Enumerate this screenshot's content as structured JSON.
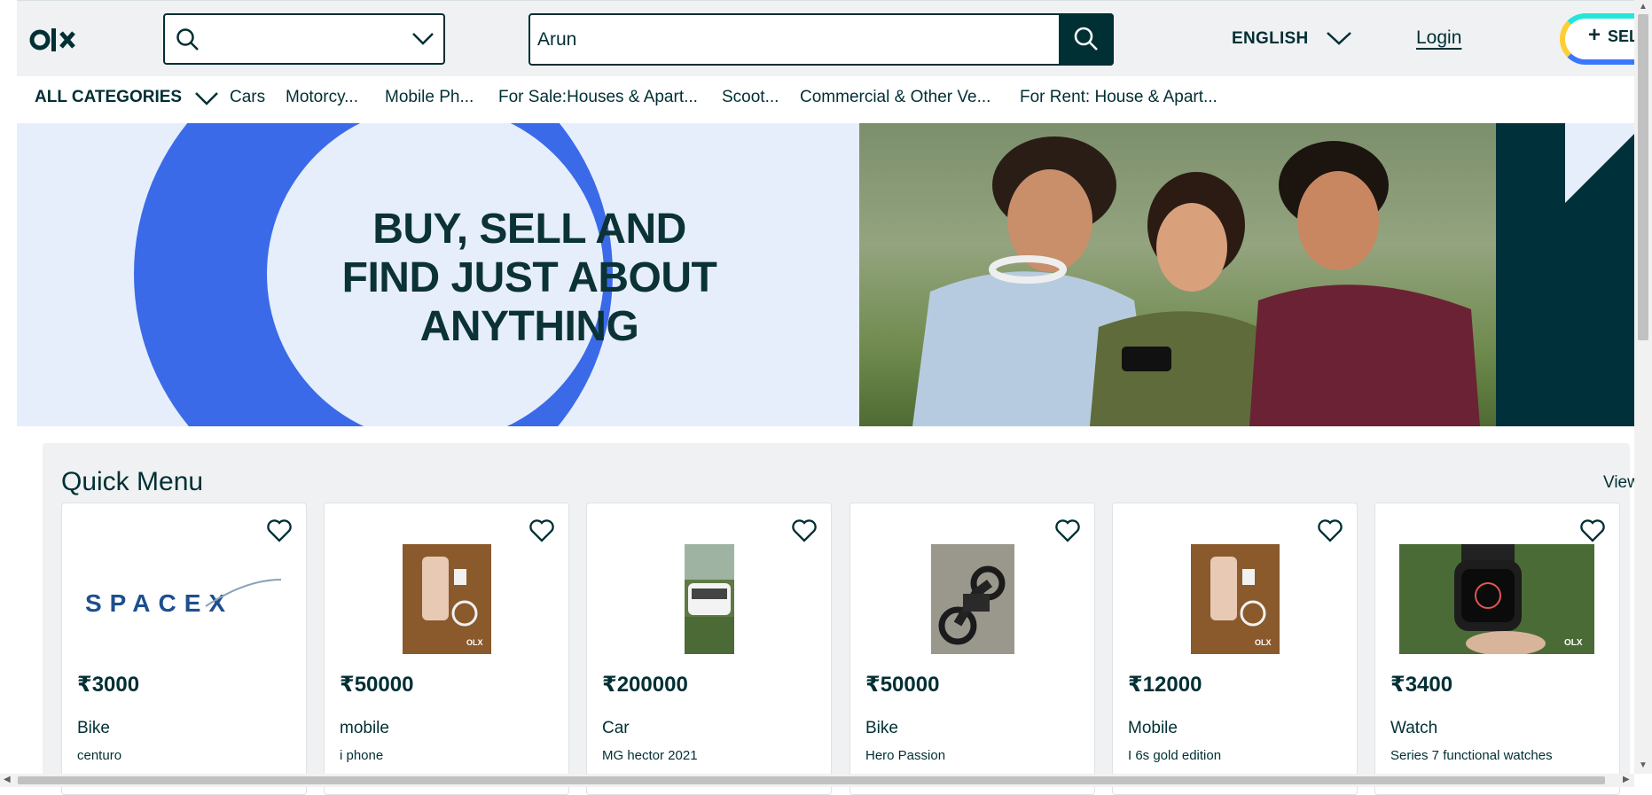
{
  "header": {
    "logo_text": "OLX",
    "location_placeholder": "",
    "search_value": "Arun",
    "language": "ENGLISH",
    "login_label": "Login",
    "sell_label": "SELL"
  },
  "categories": {
    "all_label": "ALL CATEGORIES",
    "items": [
      "Cars",
      "Motorcy...",
      "Mobile Ph...",
      "For Sale:Houses & Apart...",
      "Scoot...",
      "Commercial & Other Ve...",
      "For Rent: House & Apart..."
    ]
  },
  "banner": {
    "line1": "BUY, SELL AND",
    "line2": "FIND JUST ABOUT",
    "line3": "ANYTHING"
  },
  "quick_menu": {
    "title": "Quick Menu",
    "view_label": "View",
    "cards": [
      {
        "price": "₹3000",
        "title": "Bike",
        "subtitle": "centuro",
        "thumb": "spacex-logo"
      },
      {
        "price": "₹50000",
        "title": "mobile",
        "subtitle": "i phone",
        "thumb": "phone-photo"
      },
      {
        "price": "₹200000",
        "title": "Car",
        "subtitle": "MG hector 2021",
        "thumb": "car-photo"
      },
      {
        "price": "₹50000",
        "title": "Bike",
        "subtitle": "Hero Passion",
        "thumb": "bike-photo"
      },
      {
        "price": "₹12000",
        "title": "Mobile",
        "subtitle": "I 6s gold edition",
        "thumb": "phone-photo"
      },
      {
        "price": "₹3400",
        "title": "Watch",
        "subtitle": "Series 7 functional watches",
        "thumb": "watch-photo"
      }
    ]
  },
  "colors": {
    "primary": "#002f34",
    "header_bg": "#eff1f3",
    "banner_blue": "#3a6ae8",
    "banner_light": "#e6eefc"
  }
}
